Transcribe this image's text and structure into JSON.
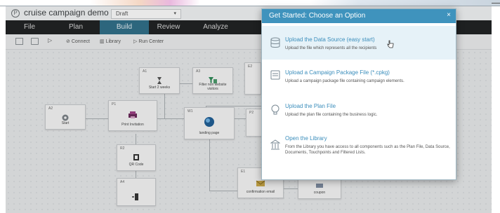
{
  "app": {
    "logo_glyph": "P",
    "campaign_title": "cruise campaign demo",
    "status": "Draft"
  },
  "nav": {
    "tabs": [
      {
        "label": "File"
      },
      {
        "label": "Plan"
      },
      {
        "label": "Build",
        "active": true
      },
      {
        "label": "Review"
      },
      {
        "label": "Analyze"
      }
    ]
  },
  "toolbar": {
    "connect": "Connect",
    "library": "Library",
    "run_center": "Run Center"
  },
  "canvas": {
    "nodes": [
      {
        "id": "A2",
        "label": "Start",
        "icon": "gear-icon"
      },
      {
        "id": "P1",
        "label": "Print Invitation",
        "icon": "printer-icon"
      },
      {
        "id": "A1",
        "label": "Start 2 weeks",
        "icon": "hourglass-icon"
      },
      {
        "id": "A3",
        "label": "Filter non website visitors",
        "icon": "filter-icon"
      },
      {
        "id": "W1",
        "label": "landing page",
        "icon": "globe-icon"
      },
      {
        "id": "R2",
        "label": "QR Code",
        "icon": "qr-icon"
      },
      {
        "id": "E1",
        "label": "confirmation email",
        "icon": "email-icon"
      },
      {
        "id": "",
        "label": "coupon",
        "icon": "coupon-icon"
      },
      {
        "id": "A4",
        "label": "",
        "icon": "mobile-icon"
      },
      {
        "id": "E2",
        "label": "",
        "icon": "email-icon"
      },
      {
        "id": "P2",
        "label": "P",
        "icon": "printer-icon"
      }
    ]
  },
  "modal": {
    "title": "Get Started: Choose an Option",
    "close_glyph": "×",
    "options": [
      {
        "title": "Upload the Data Source (easy start)",
        "description": "Upload the file which represents all the recipients",
        "icon": "database-icon"
      },
      {
        "title": "Upload a Campaign Package File (*.cpkg)",
        "description": "Upload a campaign package file containing campaign elements.",
        "icon": "package-icon"
      },
      {
        "title": "Upload the Plan File",
        "description": "Upload the plan file containing the business logic.",
        "icon": "lightbulb-icon"
      },
      {
        "title": "Open the Library",
        "description": "From the Library you have access to all components such as the Plan File, Data Source, Documents, Touchpoints and Filtered Lists.",
        "icon": "library-icon"
      }
    ]
  },
  "colors": {
    "modal_header": "#3f93bd",
    "option_title": "#3a8dbb",
    "nav_active": "#2f6f88",
    "nav_bg": "#1f2122"
  }
}
